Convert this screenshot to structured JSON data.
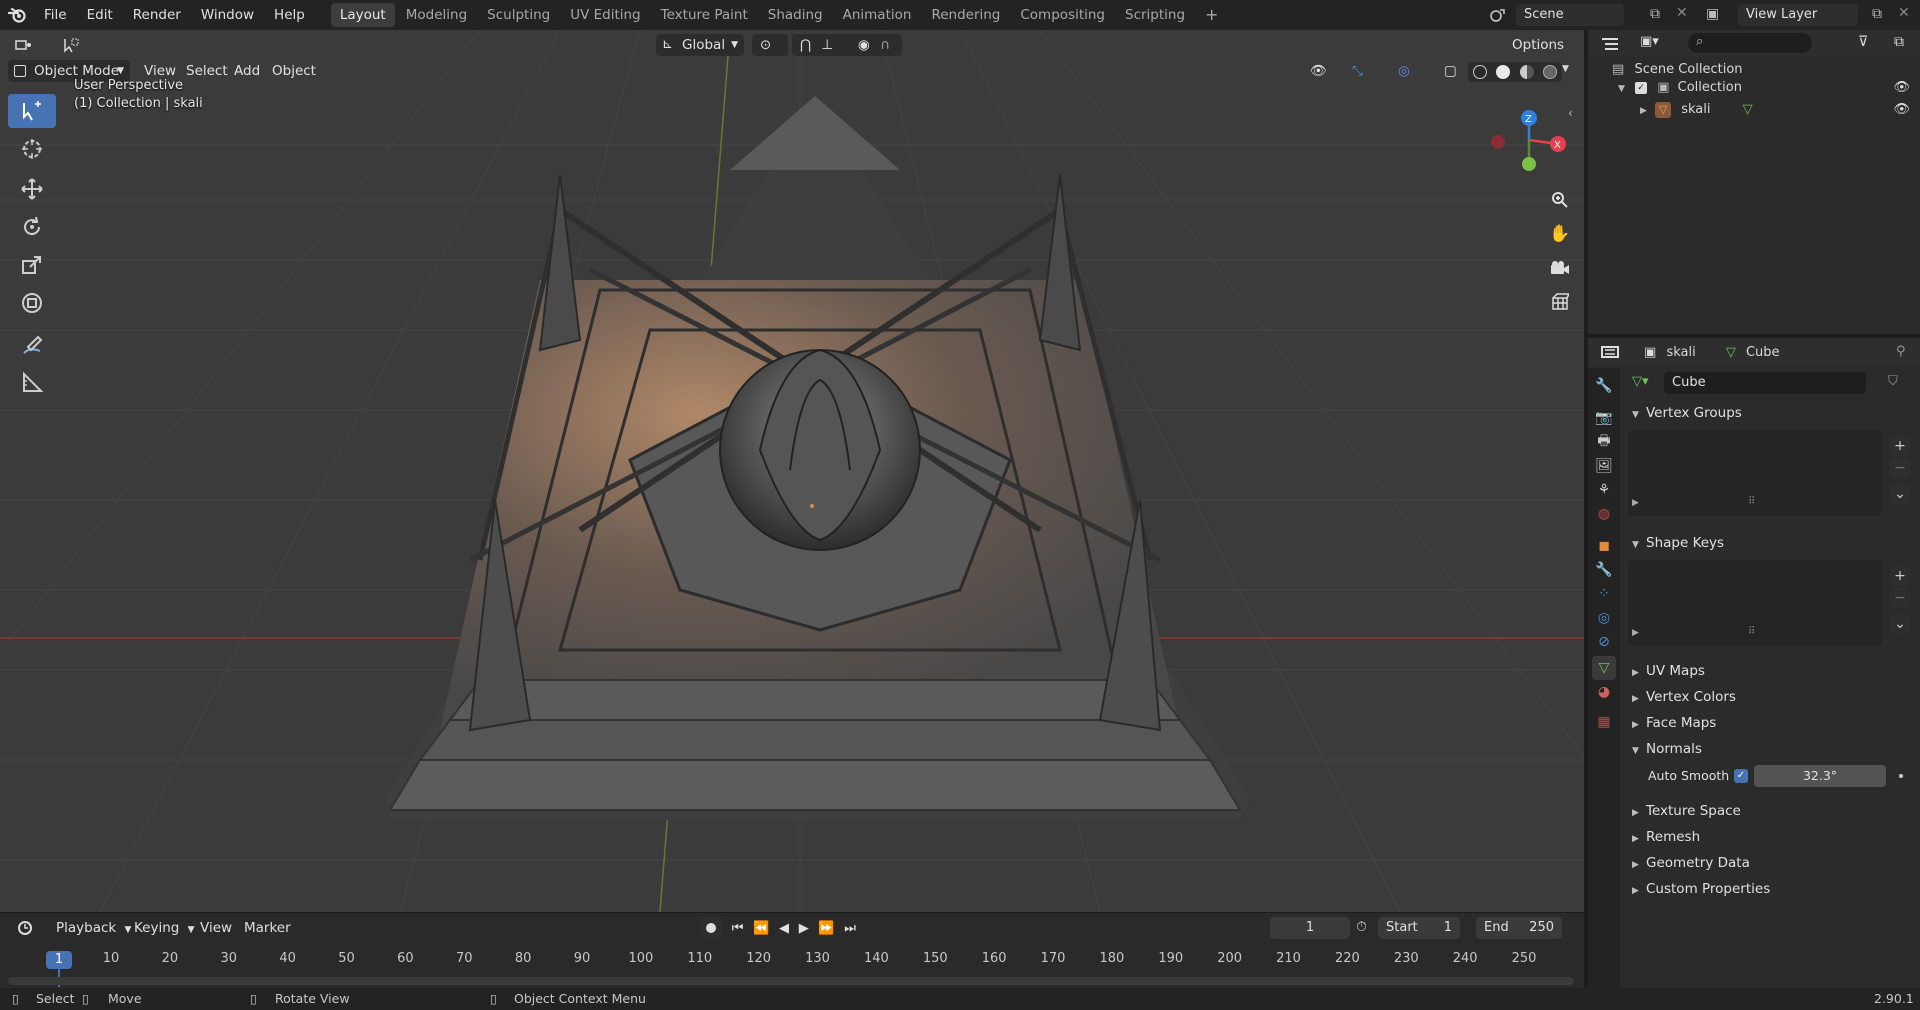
{
  "topbar": {
    "menus": [
      "File",
      "Edit",
      "Render",
      "Window",
      "Help"
    ],
    "workspaces": [
      "Layout",
      "Modeling",
      "Sculpting",
      "UV Editing",
      "Texture Paint",
      "Shading",
      "Animation",
      "Rendering",
      "Compositing",
      "Scripting"
    ],
    "active_workspace": "Layout",
    "add_tab": "+",
    "scene": "Scene",
    "view_layer": "View Layer"
  },
  "viewport_header": {
    "mode": "Object Mode",
    "menus": [
      "View",
      "Select",
      "Add",
      "Object"
    ],
    "orientation": "Global",
    "options": "Options"
  },
  "viewport": {
    "perspective_label": "User Perspective",
    "collection_label": "(1) Collection | skali",
    "gizmo_axes": {
      "z": "Z",
      "x": "X"
    },
    "colors": {
      "x_axis": "#e6404f",
      "y_axis": "#7bc143",
      "z_axis": "#2f7fe0",
      "background": "#3b3b3b"
    }
  },
  "timeline": {
    "menus": [
      "Playback",
      "Keying",
      "View",
      "Marker"
    ],
    "current_frame": "1",
    "start_label": "Start",
    "start_value": "1",
    "end_label": "End",
    "end_value": "250",
    "ticks": [
      "1",
      "10",
      "20",
      "30",
      "40",
      "50",
      "60",
      "70",
      "80",
      "90",
      "100",
      "110",
      "120",
      "130",
      "140",
      "150",
      "160",
      "170",
      "180",
      "190",
      "200",
      "210",
      "220",
      "230",
      "240",
      "250"
    ]
  },
  "statusbar": {
    "select": "Select",
    "move": "Move",
    "rotate": "Rotate View",
    "context": "Object Context Menu",
    "version": "2.90.1"
  },
  "outliner": {
    "scene_collection": "Scene Collection",
    "collection": "Collection",
    "object": "skali"
  },
  "properties": {
    "breadcrumb_object": "skali",
    "breadcrumb_data": "Cube",
    "mesh_name": "Cube",
    "sections": {
      "vertex_groups": "Vertex Groups",
      "shape_keys": "Shape Keys",
      "uv_maps": "UV Maps",
      "vertex_colors": "Vertex Colors",
      "face_maps": "Face Maps",
      "normals": "Normals",
      "texture_space": "Texture Space",
      "remesh": "Remesh",
      "geometry_data": "Geometry Data",
      "custom_properties": "Custom Properties"
    },
    "auto_smooth_label": "Auto Smooth",
    "auto_smooth_angle": "32.3°"
  }
}
